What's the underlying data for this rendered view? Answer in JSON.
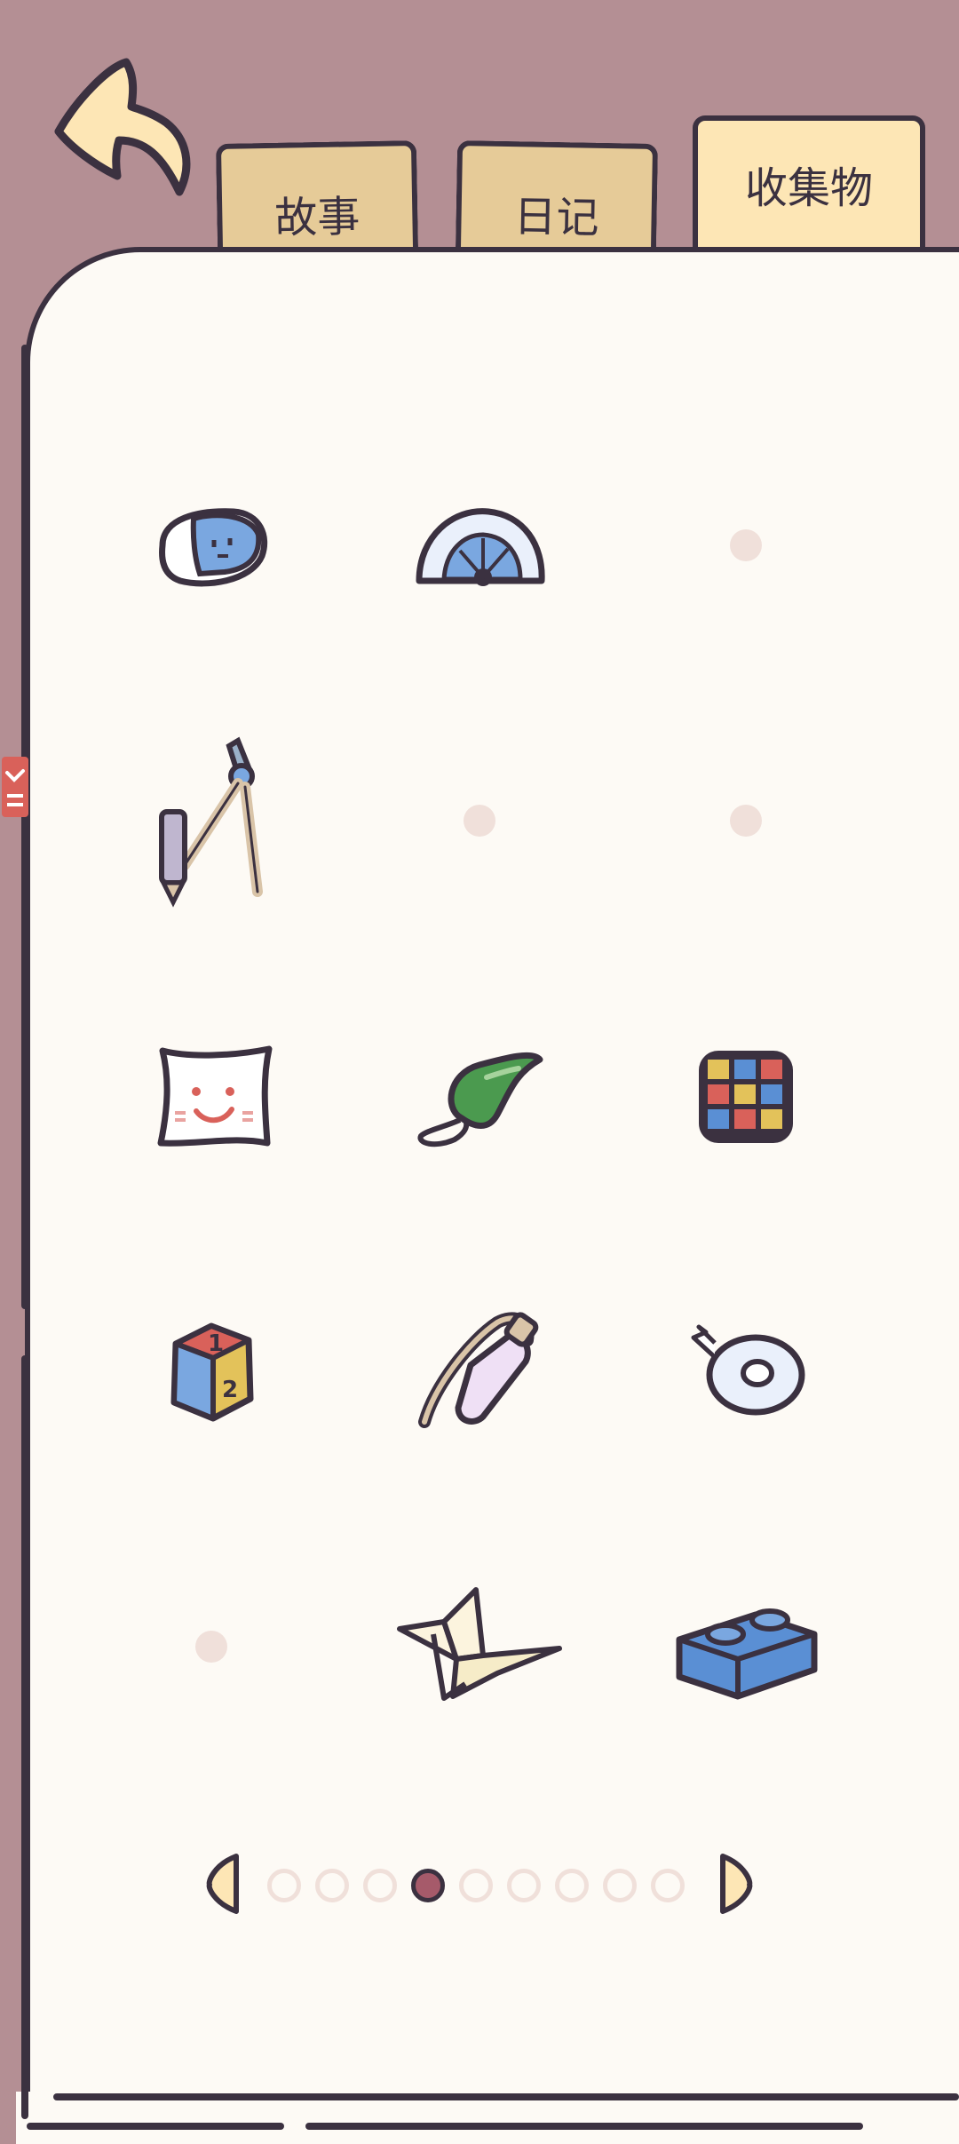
{
  "tabs": [
    {
      "label": "故事",
      "active": false
    },
    {
      "label": "日记",
      "active": false
    },
    {
      "label": "收集物",
      "active": true
    }
  ],
  "grid": [
    [
      "eraser-icon",
      "protractor-icon",
      "empty"
    ],
    [
      "compass-tool-icon",
      "empty",
      "empty"
    ],
    [
      "smiley-note-icon",
      "whistle-icon",
      "rubiks-cube-icon"
    ],
    [
      "number-block-icon",
      "paper-clip-icon",
      "tape-roll-icon"
    ],
    [
      "empty",
      "paper-crane-icon",
      "lego-brick-icon"
    ]
  ],
  "pager": {
    "page_count": 9,
    "current_page": 4
  },
  "colors": {
    "background": "#b48f94",
    "paper": "#fdfaf5",
    "outline": "#3b3140",
    "tab": "#e6cb98",
    "tab_active": "#fde6b5",
    "empty_slot": "#f0e0da",
    "pager_active": "#a65a6a"
  }
}
